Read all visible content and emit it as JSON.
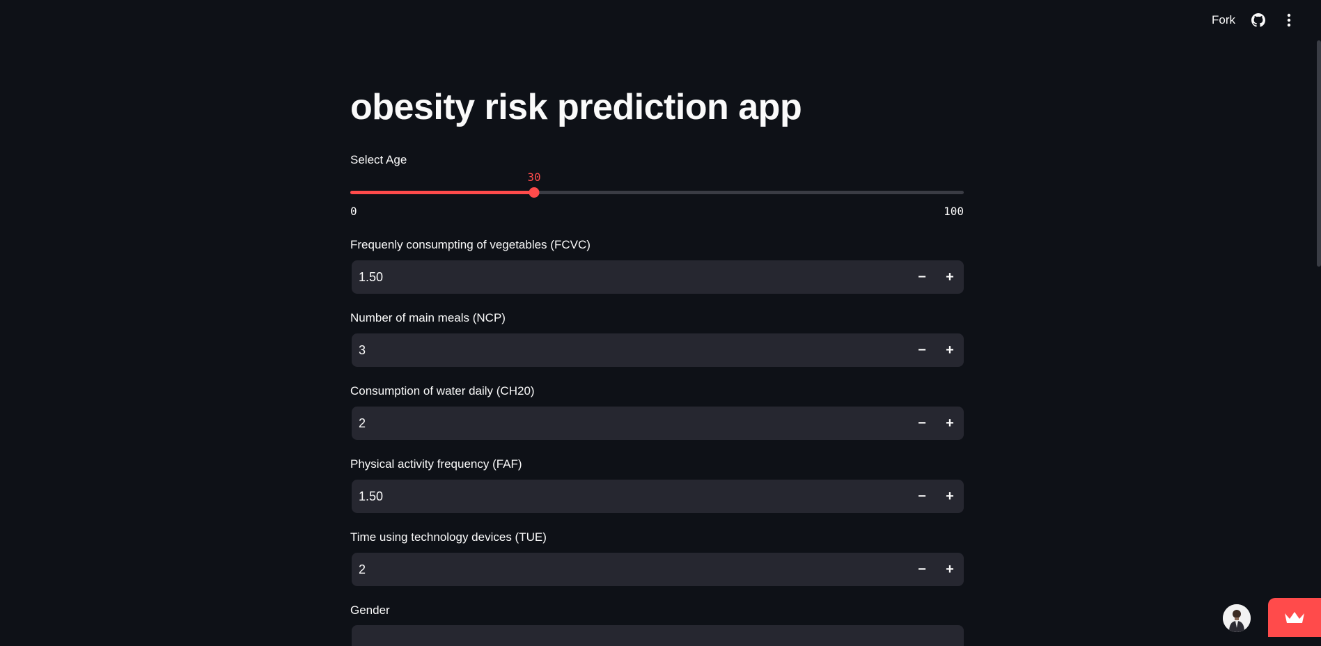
{
  "toolbar": {
    "fork_label": "Fork",
    "github_icon": "github-icon",
    "menu_icon": "more-vertical-icon"
  },
  "page": {
    "title": "obesity risk prediction app"
  },
  "age_slider": {
    "label": "Select Age",
    "value": "30",
    "min": "0",
    "max": "100",
    "value_fraction": 0.3,
    "accent_color": "#ff4b4b"
  },
  "inputs": [
    {
      "label": "Frequenly consumpting of vegetables (FCVC)",
      "value": "1.50"
    },
    {
      "label": "Number of main meals (NCP)",
      "value": "3"
    },
    {
      "label": "Consumption of water daily (CH20)",
      "value": "2"
    },
    {
      "label": "Physical activity frequency (FAF)",
      "value": "1.50"
    },
    {
      "label": "Time using technology devices (TUE)",
      "value": "2"
    }
  ],
  "stepper": {
    "minus": "−",
    "plus": "+"
  },
  "gender": {
    "label": "Gender"
  },
  "colors": {
    "background": "#0e1117",
    "input_bg": "#262730",
    "accent": "#ff4b4b"
  }
}
